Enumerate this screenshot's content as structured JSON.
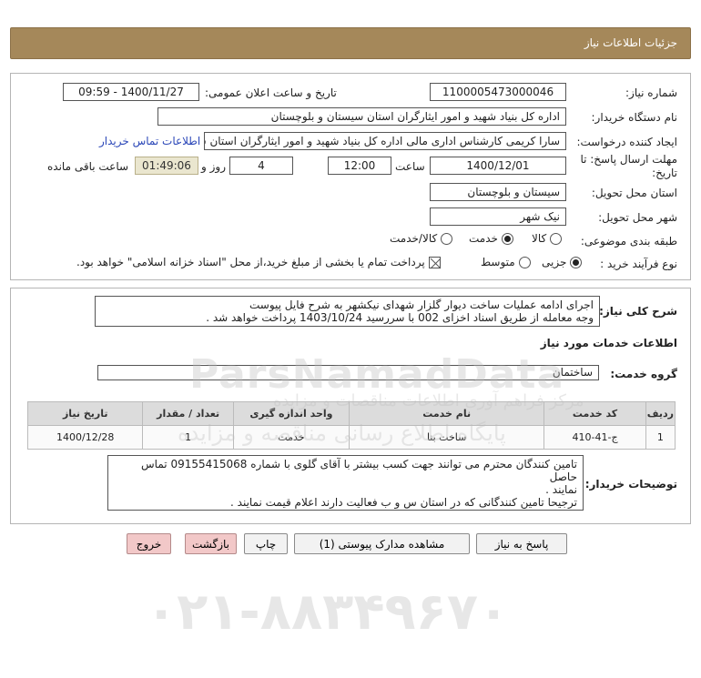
{
  "header": {
    "title": "جزئیات اطلاعات نیاز"
  },
  "fields": {
    "need_number_label": "شماره نیاز:",
    "need_number": "1100005473000046",
    "announce_label": "تاریخ و ساعت اعلان عمومی:",
    "announce_value": "1400/11/27 - 09:59",
    "buyer_org_label": "نام دستگاه خریدار:",
    "buyer_org": "اداره کل بنیاد شهید و امور ایثارگران استان سیستان و بلوچستان",
    "requester_label": "ایجاد کننده درخواست:",
    "requester": "سارا کریمی کارشناس اداری مالی اداره کل بنیاد شهید و امور ایثارگران استان س",
    "contact_link": "اطلاعات تماس خریدار",
    "deadline_label_1": "مهلت ارسال پاسخ: تا",
    "deadline_label_2": "تاریخ:",
    "deadline_date": "1400/12/01",
    "time_label": "ساعت",
    "deadline_time": "12:00",
    "days_value": "4",
    "days_label": "روز و",
    "remaining_time": "01:49:06",
    "remaining_label": "ساعت باقی مانده",
    "province_label": "استان محل تحویل:",
    "province": "سیستان و بلوچستان",
    "city_label": "شهر محل تحویل:",
    "city": "نیک شهر",
    "category_label": "طبقه بندی موضوعی:",
    "category_options": [
      "کالا",
      "خدمت",
      "کالا/خدمت"
    ],
    "category_selected": "خدمت",
    "process_label": "نوع فرآیند خرید :",
    "process_options": [
      "جزیی",
      "متوسط"
    ],
    "process_selected": "جزیی",
    "payment_note": "پرداخت تمام یا بخشی از مبلغ خرید،از محل \"اسناد خزانه اسلامی\" خواهد بود."
  },
  "summary": {
    "label": "شرح کلی نیاز:",
    "line1": "اجرای ادامه عملیات ساخت دیوار گلزار شهدای نیکشهر به شرح فایل پیوست",
    "line2": "وجه معامله از طریق اسناد اخزای 002 با سررسید 1403/10/24 پرداخت خواهد شد ."
  },
  "services": {
    "section_title": "اطلاعات خدمات مورد نیاز",
    "group_label": "گروه خدمت:",
    "group_value": "ساختمان",
    "columns": [
      "ردیف",
      "کد خدمت",
      "نام خدمت",
      "واحد اندازه گیری",
      "تعداد / مقدار",
      "تاریخ نیاز"
    ],
    "rows": [
      {
        "row": "1",
        "code": "ج-41-410",
        "name": "ساخت بنا",
        "unit": "خدمت",
        "qty": "1",
        "date": "1400/12/28"
      }
    ]
  },
  "buyer_notes": {
    "label": "توضیحات خریدار:",
    "line1": "تامین کنندگان محترم می توانند جهت کسب بیشتر با آقای گلوی با شماره 09155415068 تماس حاصل",
    "line2": "نمایند .",
    "line3": "ترجیحا تامین کنندگانی که در استان س و ب فعالیت دارند اعلام قیمت نمایند ."
  },
  "buttons": {
    "reply": "پاسخ به نیاز",
    "attachments": "مشاهده مدارک پیوستی (1)",
    "print": "چاپ",
    "back": "بازگشت",
    "exit": "خروج"
  },
  "watermark": {
    "line1": "ParsNamadData",
    "line2": "مرکز فراهم آوری اطلاعات مناقصات و مزایده",
    "line3": "پایگاه اطلاع رسانی مناقصه و مزایده",
    "phone": "۰۲۱-۸۸۳۴۹۶۷۰"
  },
  "colors": {
    "header_bg": "#a5885a",
    "remaining_bg": "#eae6cf",
    "link": "#2b47b8",
    "pink_button": "#f2c8c8"
  }
}
